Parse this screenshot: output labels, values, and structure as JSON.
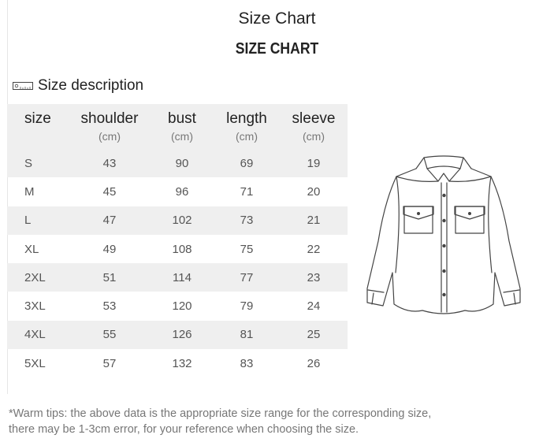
{
  "page": {
    "title": "Size Chart",
    "chart_heading": "SIZE CHART",
    "section_title": "Size description",
    "section_icon": "ruler-icon"
  },
  "table": {
    "columns": [
      {
        "label": "size",
        "unit": ""
      },
      {
        "label": "shoulder",
        "unit": "(cm)"
      },
      {
        "label": "bust",
        "unit": "(cm)"
      },
      {
        "label": "length",
        "unit": "(cm)"
      },
      {
        "label": "sleeve",
        "unit": "(cm)"
      }
    ],
    "rows": [
      [
        "S",
        "43",
        "90",
        "69",
        "19"
      ],
      [
        "M",
        "45",
        "96",
        "71",
        "20"
      ],
      [
        "L",
        "47",
        "102",
        "73",
        "21"
      ],
      [
        "XL",
        "49",
        "108",
        "75",
        "22"
      ],
      [
        "2XL",
        "51",
        "114",
        "77",
        "23"
      ],
      [
        "3XL",
        "53",
        "120",
        "79",
        "24"
      ],
      [
        "4XL",
        "55",
        "126",
        "81",
        "25"
      ],
      [
        "5XL",
        "57",
        "132",
        "83",
        "26"
      ]
    ]
  },
  "illustration": {
    "icon": "shirt-illustration"
  },
  "tips": {
    "line1": "*Warm tips: the above data is the appropriate size range for the corresponding size,",
    "line2": "there may be 1-3cm error, for your reference when choosing the size."
  }
}
